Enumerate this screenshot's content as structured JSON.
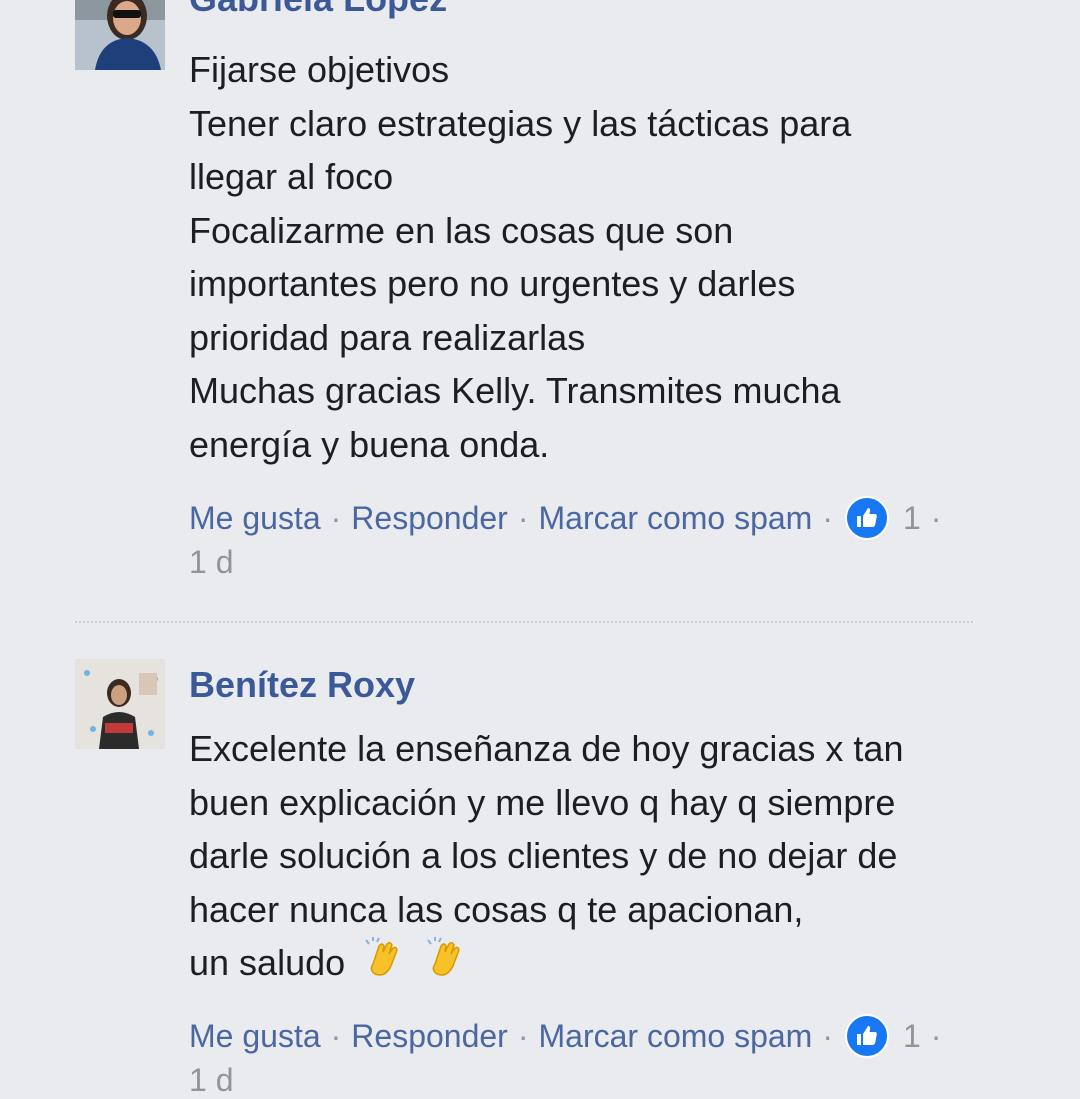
{
  "comments": [
    {
      "author": "Gabriela López",
      "avatar_icon": "profile-photo",
      "lines": [
        "Fijarse objetivos",
        "Tener claro estrategias y las tácticas para",
        "llegar al foco",
        "Focalizarme en las cosas que son",
        "importantes pero no urgentes y darles",
        "prioridad para realizarlas",
        "Muchas gracias Kelly. Transmites mucha",
        "energía y buena onda."
      ],
      "actions": {
        "like": "Me gusta",
        "reply": "Responder",
        "spam": "Marcar como spam",
        "like_count": "1",
        "time": "1 d"
      }
    },
    {
      "author": "Benítez Roxy",
      "avatar_icon": "profile-photo",
      "lines": [
        "Excelente la enseñanza de hoy gracias x tan",
        "buen explicación y me llevo q hay q siempre",
        "darle solución a los clientes y de no dejar de",
        "hacer nunca las cosas q te apacionan,",
        "un saludo"
      ],
      "emoji": [
        "clapping-hands-icon",
        "clapping-hands-icon"
      ],
      "actions": {
        "like": "Me gusta",
        "reply": "Responder",
        "spam": "Marcar como spam",
        "like_count": "1",
        "time": "1 d"
      }
    }
  ],
  "separator": "·",
  "colors": {
    "background": "#e9ebee",
    "author": "#3b5998",
    "link": "#4b67a1",
    "meta": "#90949c",
    "like_badge": "#1877f2"
  }
}
